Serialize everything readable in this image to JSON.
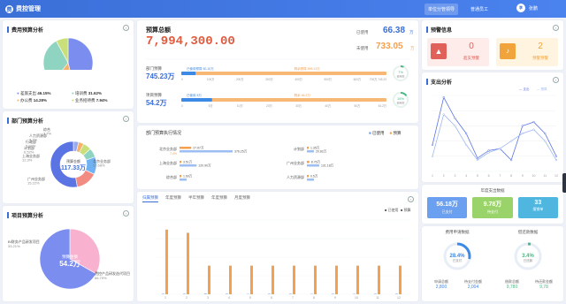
{
  "app": {
    "title": "费控管理",
    "logo_glyph": "费"
  },
  "nav": {
    "items": [
      "单位分管领导",
      "普通员工"
    ],
    "active": 0
  },
  "user": {
    "avatar": "李",
    "name": "张鹏"
  },
  "cost_budget": {
    "title": "费用预算分析",
    "legend": [
      {
        "name": "差旅支出",
        "pct": "46.15%",
        "value": 46.15,
        "color": "#7b8ef0"
      },
      {
        "name": "办公费",
        "pct": "14.28%",
        "value": 14.28,
        "color": "#f6b26b"
      },
      {
        "name": "培训费",
        "pct": "31.62%",
        "value": 31.62,
        "color": "#8fd4c1"
      },
      {
        "name": "业务招待费",
        "pct": "7.94%",
        "value": 7.94,
        "color": "#c9e07a"
      }
    ]
  },
  "dept_budget": {
    "title": "部门预算分析",
    "center_label": "预算金额",
    "center_value": "117.33万",
    "labels": [
      {
        "name": "综合",
        "pct": "3.7%"
      },
      {
        "name": "人力资源部",
        "pct": "3.7%"
      },
      {
        "name": "行政部",
        "pct": "5.84%"
      },
      {
        "name": "计划部",
        "pct": "6.52%"
      },
      {
        "name": "上海业务部",
        "pct": "12.3%"
      },
      {
        "name": "广州业务部",
        "pct": "15.22%"
      },
      {
        "name": "北京业务部",
        "pct": "52.68%"
      }
    ],
    "colors": [
      "#9aa8f0",
      "#f6b26b",
      "#c9e07a",
      "#8fd4c1",
      "#6fb1f2",
      "#f28b82",
      "#5b74e4"
    ]
  },
  "project_budget": {
    "title": "项目预算分析",
    "center_label": "预算金额",
    "center_value": "54.2万",
    "labels": [
      {
        "name": "BI财务产品研发项目",
        "pct": "33.21%"
      },
      {
        "name": "费控产品研发迭代项目",
        "pct": "66.79%"
      }
    ],
    "colors": [
      "#f8b2cf",
      "#7b8ef0"
    ]
  },
  "budget_total": {
    "title": "预算总额",
    "amount": "7,994,300.00",
    "used_label": "已使用",
    "used_value": "66.38",
    "used_unit": "万",
    "remain_label": "未使用",
    "remain_value": "733.05",
    "remain_unit": "万"
  },
  "budget_rows": [
    {
      "label": "部门预算",
      "value": "745.23万",
      "progress_label": "已使用预算 50.10万",
      "remain_label": "剩余预算 695.13万",
      "used_fraction": 0.07,
      "ring_pct": "7%",
      "ring_label": "使用率",
      "ring_color": "#48b884",
      "ticks": [
        "0",
        "100万",
        "200万",
        "300万",
        "400万",
        "500万",
        "600万",
        "700万 745.23"
      ]
    },
    {
      "label": "项目预算",
      "value": "54.2万",
      "progress_label": "已使用 8万",
      "remain_label": "剩余 46.2万",
      "used_fraction": 0.15,
      "ring_pct": "15%",
      "ring_label": "使用率",
      "ring_color": "#48b884",
      "ticks": [
        "0",
        "5万",
        "10万",
        "20万",
        "30万",
        "40万",
        "50万",
        "54.2万"
      ]
    }
  ],
  "dept_exec": {
    "title": "部门预算执行情况",
    "legend": [
      "已使用",
      "预算"
    ],
    "items": [
      {
        "name": "北京业务部",
        "used": "27.67万",
        "budget": "376.25万",
        "used_v": 27.67,
        "budget_v": 376.25,
        "pct": "7.4%"
      },
      {
        "name": "计划部",
        "used": "1.35万",
        "budget": "20.82万",
        "used_v": 1.35,
        "budget_v": 20.82,
        "pct": ""
      },
      {
        "name": "上海业务部",
        "used": "3.51万",
        "budget": "120.90万",
        "used_v": 3.51,
        "budget_v": 120.9,
        "pct": ""
      },
      {
        "name": "广州业务部",
        "used": "8.76万",
        "budget": "131.18万",
        "used_v": 8.76,
        "budget_v": 131.18,
        "pct": ""
      },
      {
        "name": "综合部",
        "used": "1.60万",
        "budget": "",
        "used_v": 1.6,
        "budget_v": 36.5,
        "pct": ""
      },
      {
        "name": "人力资源部",
        "used": "0.5万",
        "budget": "",
        "used_v": 0.5,
        "budget_v": 38.2,
        "pct": ""
      }
    ]
  },
  "monthly_tabs": [
    "归属预算",
    "年度预算",
    "半年预算",
    "年度预算",
    "月度预算"
  ],
  "chart_data": [
    {
      "type": "bar",
      "legend": [
        "已使用",
        "预算"
      ],
      "categories": [
        "1",
        "2",
        "3",
        "4",
        "5",
        "6",
        "7",
        "8",
        "9",
        "10",
        "11",
        "12"
      ],
      "series": [
        {
          "name": "已使用",
          "values": [
            3,
            3,
            4,
            3,
            2,
            3,
            3,
            2,
            3,
            2,
            3,
            3
          ],
          "color": "#3d8ae6"
        },
        {
          "name": "预算",
          "values": [
            610,
            580,
            270,
            270,
            270,
            270,
            270,
            270,
            270,
            270,
            270,
            270
          ],
          "color": "#f5a04f"
        }
      ],
      "ylim": [
        0,
        700
      ]
    },
    {
      "type": "line",
      "legend": [
        "支出",
        "预算"
      ],
      "categories": [
        "1",
        "2",
        "3",
        "4",
        "5",
        "6",
        "7",
        "8",
        "9",
        "10",
        "11",
        "12"
      ],
      "series": [
        {
          "name": "支出",
          "values": [
            14,
            39,
            28,
            20,
            7,
            11,
            12,
            6,
            24,
            26,
            20,
            8
          ],
          "color": "#5b74e4"
        },
        {
          "name": "预算",
          "values": [
            8,
            30,
            24,
            14,
            6,
            10,
            12,
            16,
            20,
            22,
            16,
            6
          ],
          "color": "#9db6f0"
        }
      ],
      "ylim": [
        0,
        40
      ]
    }
  ],
  "warnings": {
    "title": "预警信息",
    "items": [
      {
        "count": "0",
        "label": "超支预警",
        "color": "#e0615a",
        "bg": "#fdecea",
        "icon": "warning-icon"
      },
      {
        "count": "2",
        "label": "预警预警",
        "color": "#f2a43c",
        "bg": "#fff4e0",
        "icon": "bell-icon"
      }
    ]
  },
  "expense_analysis": {
    "title": "支出分析"
  },
  "annual_expense": {
    "title": "年度支出数据",
    "cards": [
      {
        "value": "56.18万",
        "label": "已支付",
        "color": "#6aa0ef"
      },
      {
        "value": "9.78万",
        "label": "待支付",
        "color": "#9bd36b"
      },
      {
        "value": "33",
        "label": "报销单",
        "color": "#4fb6e0"
      }
    ]
  },
  "expense_report": {
    "title": "费用申请数据",
    "ring_pct": "28.4%",
    "ring_label": "已支付",
    "ring_value": 28.4,
    "ring_color": "#3d8ae6",
    "left_label": "申请总额",
    "left_value": "2,800",
    "right_label": "待支付金额",
    "right_value": "2,004"
  },
  "reimb_report": {
    "title": "借还款数据",
    "ring_pct": "3.4%",
    "ring_label": "已还款",
    "ring_value": 3.4,
    "ring_color": "#48b884",
    "left_label": "借款总额",
    "left_value": "9,780",
    "right_label": "待还款金额",
    "right_value": "9,78"
  }
}
